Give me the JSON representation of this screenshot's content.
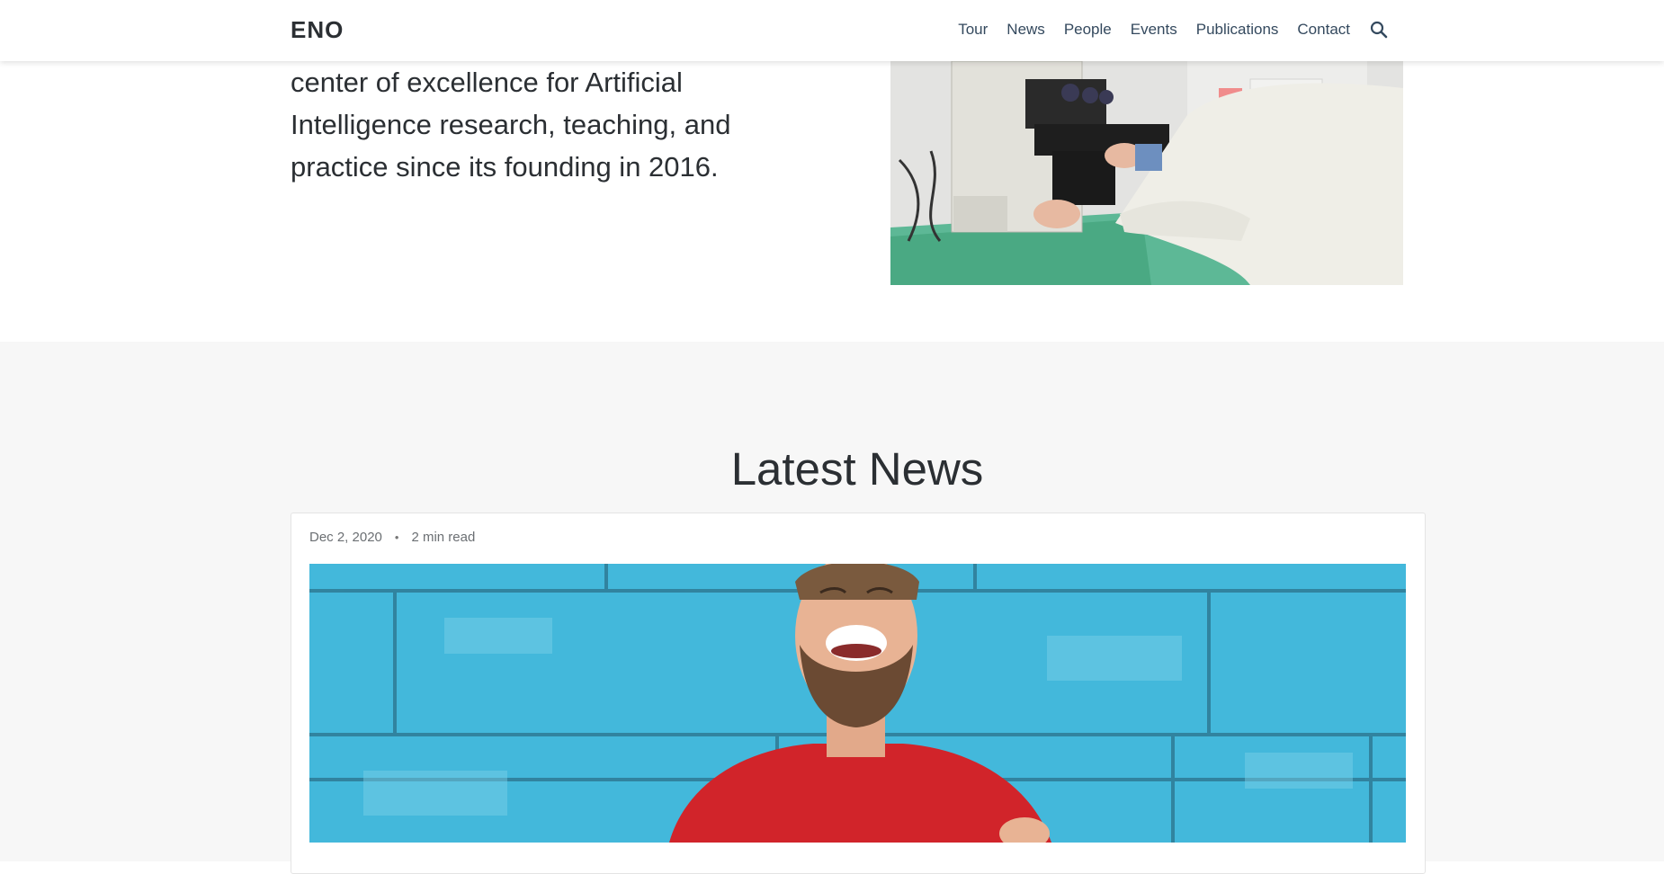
{
  "header": {
    "brand": "ENO",
    "nav": [
      "Tour",
      "News",
      "People",
      "Events",
      "Publications",
      "Contact"
    ],
    "search_icon": "search-icon"
  },
  "hero": {
    "text": "center of excellence for Artificial Intelligence research, teaching, and practice since its founding in 2016.",
    "image_icon": "lab-scientist-microscope-photo"
  },
  "news": {
    "title": "Latest News",
    "date": "Dec 2, 2020",
    "separator": "•",
    "read_time": "2 min read",
    "image_icon": "laughing-man-blue-wall-photo"
  },
  "colors": {
    "section_bg": "#f7f7f7",
    "text": "#2b2f33",
    "nav_text": "#34495e"
  }
}
